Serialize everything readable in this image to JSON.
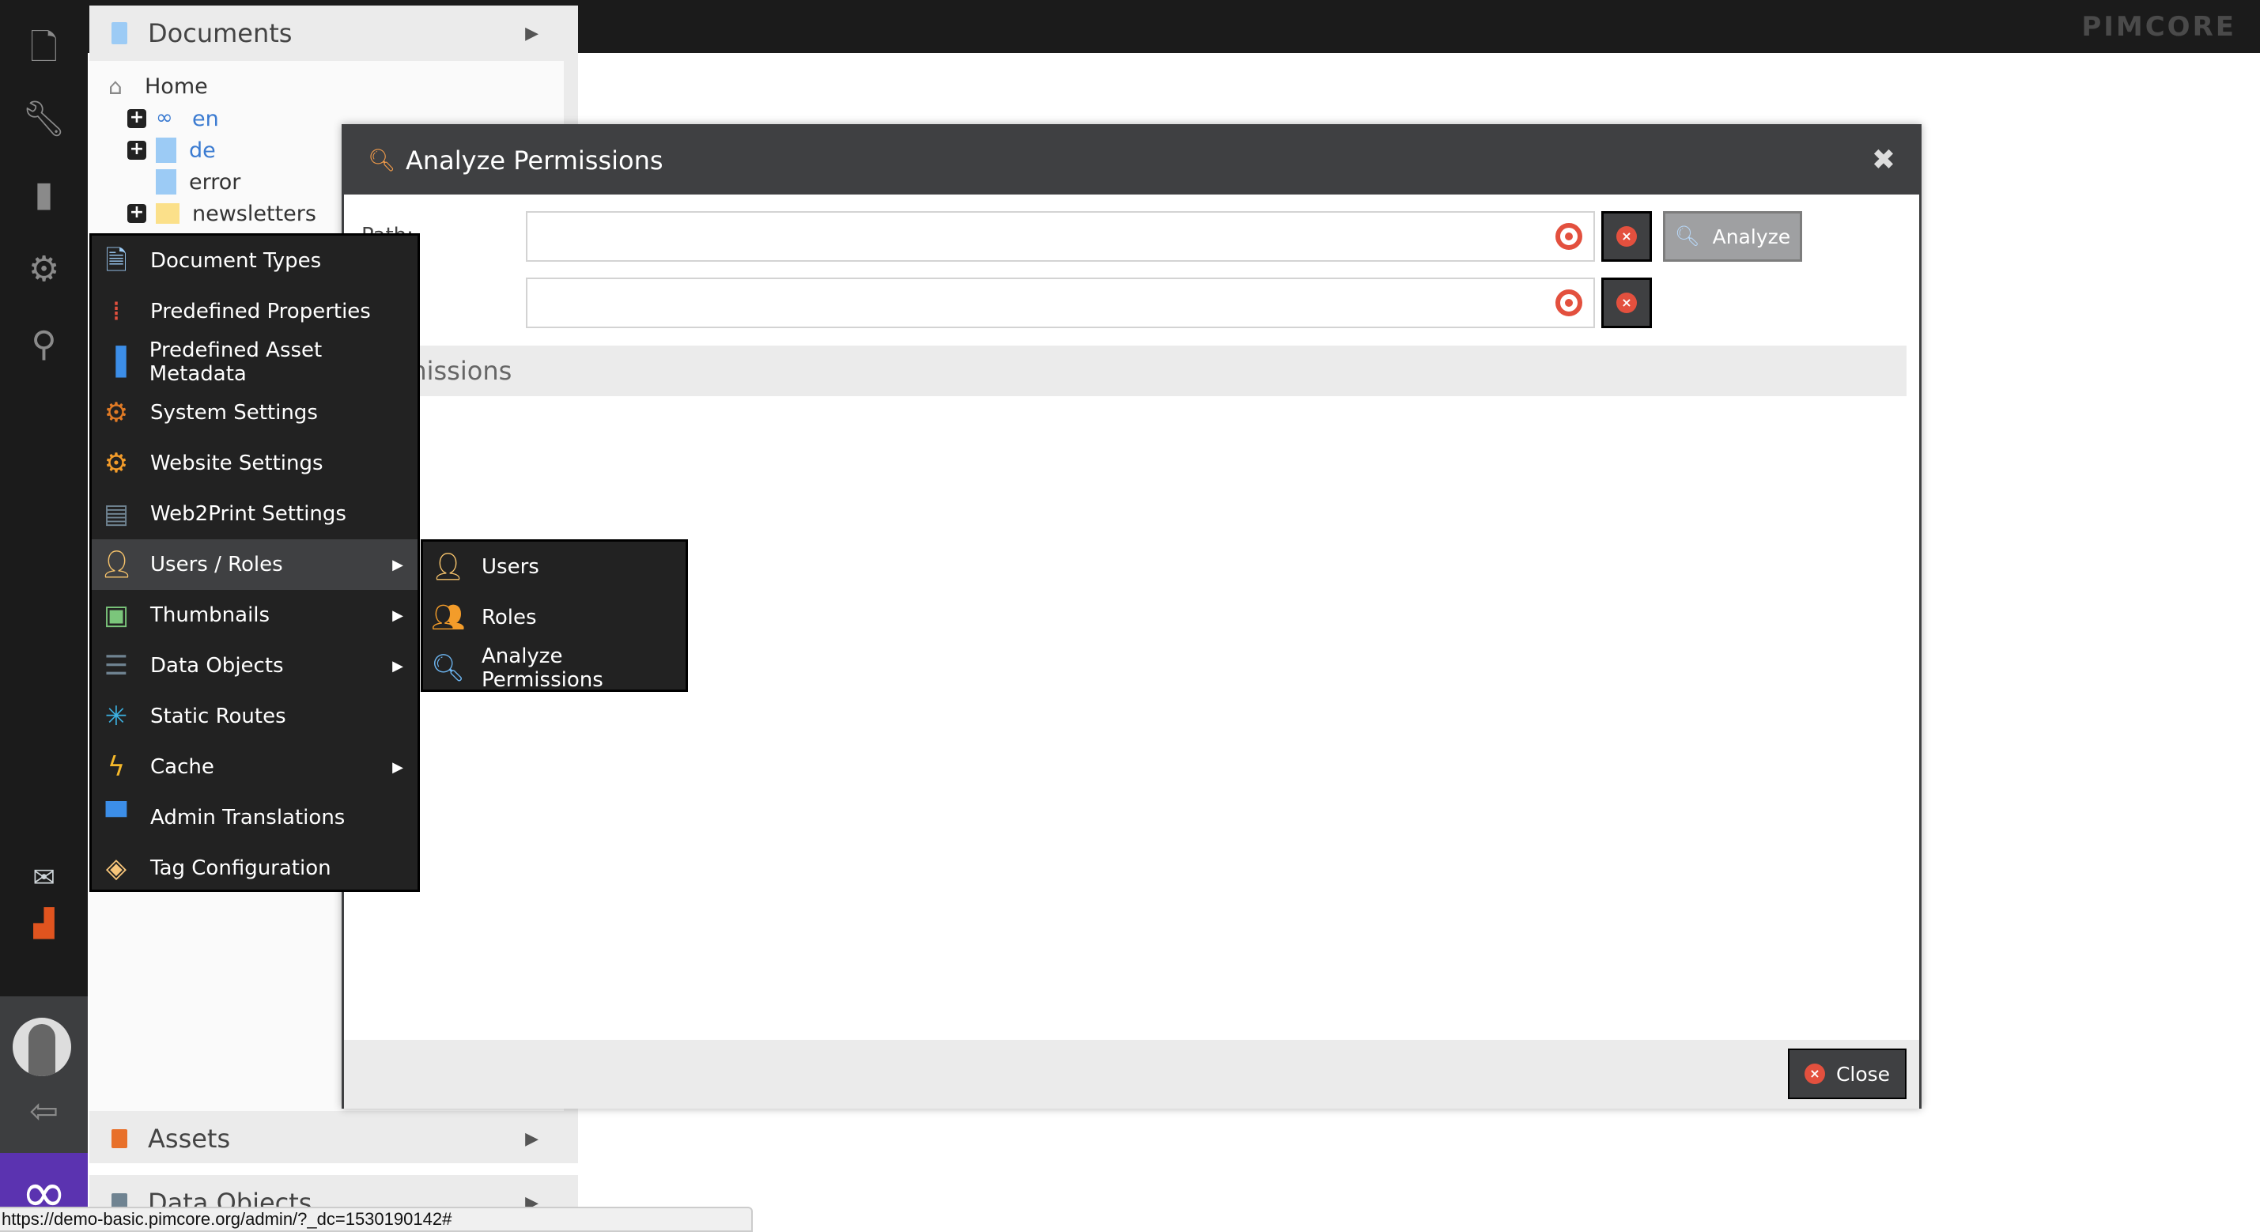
{
  "brand": {
    "logo": "PIMCORE"
  },
  "sidebar": {
    "icons": [
      "document-icon",
      "wrench-icon",
      "bar-chart-icon",
      "gear-icon",
      "search-icon",
      "mail-icon",
      "factory-icon",
      "avatar",
      "logout-icon"
    ]
  },
  "documents_panel": {
    "title": "Documents",
    "tree": [
      {
        "label": "Home"
      },
      {
        "label": "en"
      },
      {
        "label": "de"
      },
      {
        "label": "error"
      },
      {
        "label": "newsletters"
      }
    ]
  },
  "assets_panel": {
    "title": "Assets"
  },
  "data_objects_panel": {
    "title": "Data Objects"
  },
  "menu": {
    "items": [
      {
        "label": "Document Types",
        "icon": "document-wrench-icon"
      },
      {
        "label": "Predefined Properties",
        "icon": "properties-icon"
      },
      {
        "label": "Predefined Asset Metadata",
        "icon": "metadata-icon"
      },
      {
        "label": "System Settings",
        "icon": "gears-icon"
      },
      {
        "label": "Website Settings",
        "icon": "website-settings-icon"
      },
      {
        "label": "Web2Print Settings",
        "icon": "print-settings-icon"
      },
      {
        "label": "Users / Roles",
        "icon": "user-icon"
      },
      {
        "label": "Thumbnails",
        "icon": "thumbnail-icon"
      },
      {
        "label": "Data Objects",
        "icon": "data-objects-icon"
      },
      {
        "label": "Static Routes",
        "icon": "routes-icon"
      },
      {
        "label": "Cache",
        "icon": "lightning-icon"
      },
      {
        "label": "Admin Translations",
        "icon": "translations-icon"
      },
      {
        "label": "Tag Configuration",
        "icon": "tag-icon"
      }
    ],
    "submenu": [
      {
        "label": "Users",
        "icon": "user-icon"
      },
      {
        "label": "Roles",
        "icon": "group-icon"
      },
      {
        "label": "Analyze Permissions",
        "icon": "magnifier-icon"
      }
    ]
  },
  "dialog": {
    "title": "Analyze Permissions",
    "path_label": "Path:",
    "path_value": "",
    "user_value": "",
    "analyze_label": "Analyze",
    "permissions_title": "Permissions",
    "close_label": "Close"
  },
  "status_bar": {
    "url": "https://demo-basic.pimcore.org/admin/?_dc=1530190142#"
  }
}
